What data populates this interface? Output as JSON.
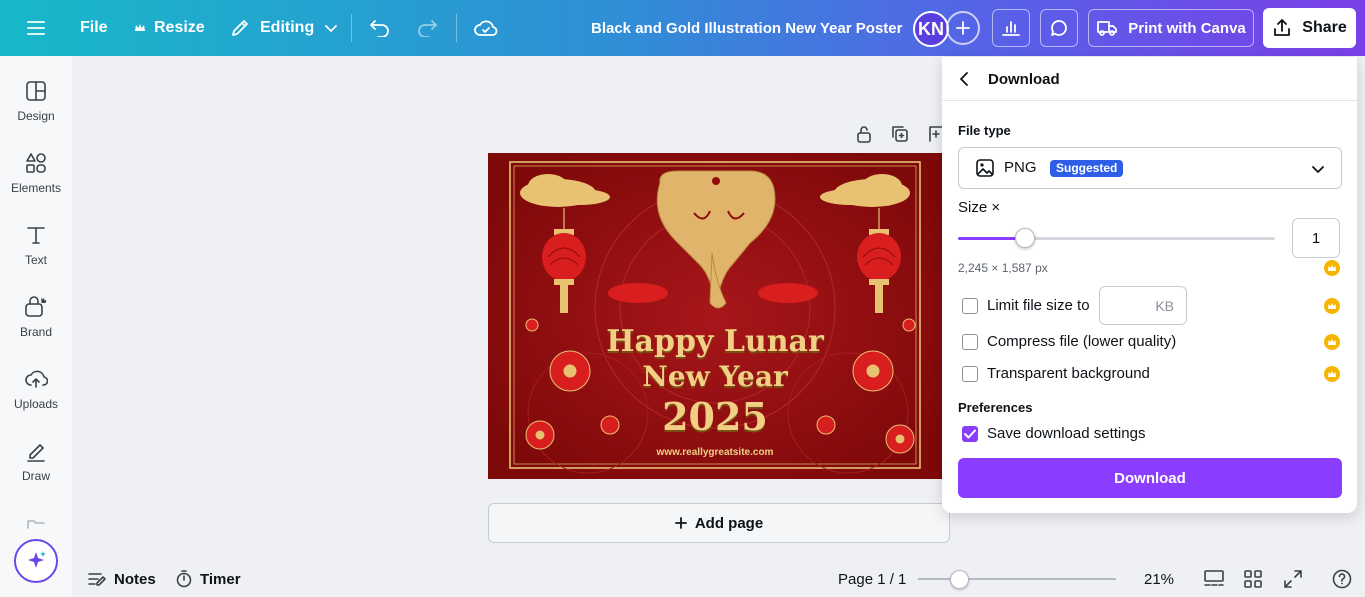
{
  "header": {
    "menu_icon": "hamburger-icon",
    "file_label": "File",
    "resize_label": "Resize",
    "editing_label": "Editing",
    "doc_title": "Black and Gold Illustration New Year Poster",
    "avatar_initials": "KN",
    "print_label": "Print with Canva",
    "share_label": "Share"
  },
  "sidebar": {
    "items": [
      {
        "label": "Design",
        "icon": "design-icon"
      },
      {
        "label": "Elements",
        "icon": "elements-icon"
      },
      {
        "label": "Text",
        "icon": "text-icon"
      },
      {
        "label": "Brand",
        "icon": "brand-icon"
      },
      {
        "label": "Uploads",
        "icon": "uploads-icon"
      },
      {
        "label": "Draw",
        "icon": "draw-icon"
      }
    ]
  },
  "poster": {
    "line1": "Happy Lunar",
    "line2": "New Year",
    "year": "2025",
    "website": "www.reallygreatsite.com"
  },
  "canvas": {
    "add_page_label": "Add page"
  },
  "footer": {
    "notes_label": "Notes",
    "timer_label": "Timer",
    "page_label": "Page 1 / 1",
    "zoom_label": "21%",
    "zoom_level": 0.21
  },
  "download_panel": {
    "title": "Download",
    "file_type_label": "File type",
    "file_type_value": "PNG",
    "suggested_badge": "Suggested",
    "size_label": "Size ×",
    "size_value": "1",
    "size_slider_fraction": 0.21,
    "dimensions": "2,245 × 1,587 px",
    "limit_size_label": "Limit file size to",
    "kb_unit": "KB",
    "compress_label": "Compress file (lower quality)",
    "transparent_label": "Transparent background",
    "preferences_label": "Preferences",
    "save_settings_label": "Save download settings",
    "save_settings_checked": true,
    "download_button": "Download"
  },
  "colors": {
    "accent": "#8b3dff",
    "poster_red": "#8e0b0b",
    "gold": "#e8c173",
    "crown": "#f7b500",
    "badge": "#2e5de8"
  }
}
